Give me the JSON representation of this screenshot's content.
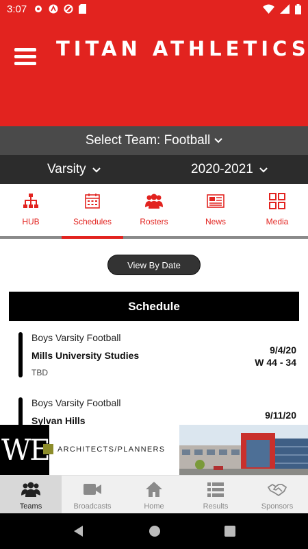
{
  "status": {
    "time": "3:07"
  },
  "header": {
    "logo_text": "TITAN ATHLETICS"
  },
  "team_select": {
    "label": "Select Team:",
    "value": "Football"
  },
  "filters": {
    "level": "Varsity",
    "season": "2020-2021"
  },
  "tabs": [
    {
      "label": "HUB",
      "icon": "hierarchy-icon"
    },
    {
      "label": "Schedules",
      "icon": "calendar-icon"
    },
    {
      "label": "Rosters",
      "icon": "people-icon"
    },
    {
      "label": "News",
      "icon": "newspaper-icon"
    },
    {
      "label": "Media",
      "icon": "grid-icon"
    }
  ],
  "active_tab": "Schedules",
  "view_button": "View By Date",
  "schedule": {
    "title": "Schedule",
    "games": [
      {
        "team": "Boys Varsity Football",
        "opponent": "Mills University Studies",
        "location": "TBD",
        "date": "9/4/20",
        "result": "W 44 - 34"
      },
      {
        "team": "Boys Varsity Football",
        "opponent": "Sylvan Hills",
        "location": "",
        "date": "9/11/20",
        "result": ""
      }
    ]
  },
  "ad": {
    "logo_text": "WER",
    "tagline": "ARCHITECTS/PLANNERS"
  },
  "bottom_nav": [
    {
      "label": "Teams",
      "icon": "team-icon"
    },
    {
      "label": "Broadcasts",
      "icon": "video-camera-icon"
    },
    {
      "label": "Home",
      "icon": "home-icon"
    },
    {
      "label": "Results",
      "icon": "list-icon"
    },
    {
      "label": "Sponsors",
      "icon": "handshake-icon"
    }
  ],
  "colors": {
    "brand_red": "#e2231f",
    "dark_bar": "#2c2c2c",
    "mid_bar": "#4a4a4a"
  }
}
